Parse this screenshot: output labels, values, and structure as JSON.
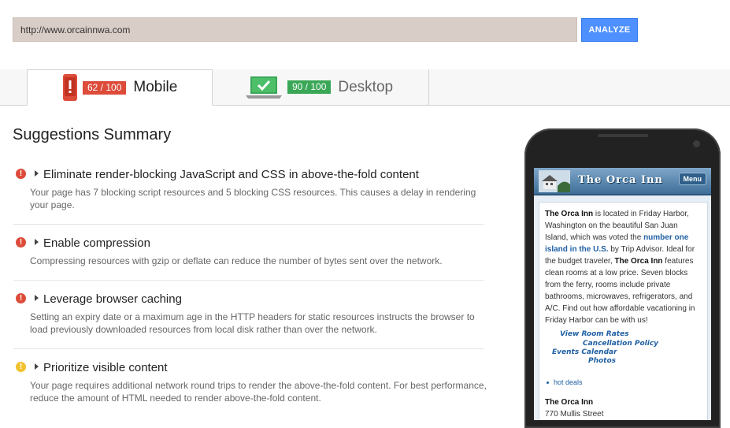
{
  "url_bar": {
    "value": "http://www.orcainnwa.com",
    "analyze_label": "ANALYZE"
  },
  "tabs": [
    {
      "label": "Mobile",
      "score": "62 / 100",
      "icon": "phone-warning-icon",
      "active": true
    },
    {
      "label": "Desktop",
      "score": "90 / 100",
      "icon": "laptop-check-icon",
      "active": false
    }
  ],
  "summary": {
    "title": "Suggestions Summary",
    "items": [
      {
        "severity": "red",
        "title": "Eliminate render-blocking JavaScript and CSS in above-the-fold content",
        "description": "Your page has 7 blocking script resources and 5 blocking CSS resources. This causes a delay in rendering your page."
      },
      {
        "severity": "red",
        "title": "Enable compression",
        "description": "Compressing resources with gzip or deflate can reduce the number of bytes sent over the network."
      },
      {
        "severity": "red",
        "title": "Leverage browser caching",
        "description": "Setting an expiry date or a maximum age in the HTTP headers for static resources instructs the browser to load previously downloaded resources from local disk rather than over the network."
      },
      {
        "severity": "yellow",
        "title": "Prioritize visible content",
        "description": "Your page requires additional network round trips to render the above-the-fold content. For best performance, reduce the amount of HTML needed to render above-the-fold content."
      }
    ]
  },
  "preview": {
    "site_title": "The Orca Inn",
    "menu_label": "Menu",
    "para_name": "The Orca Inn",
    "para_1": " is located in Friday Harbor, Washington on the beautiful San Juan Island, which was voted the ",
    "para_link": "number one island in the U.S.",
    "para_2": " by Trip Advisor. Ideal for the budget traveler, ",
    "para_name_2": "The Orca Inn",
    "para_3": " features clean rooms at a low price. Seven blocks from the ferry, rooms include private bathrooms, microwaves, refrigerators, and A/C. Find out how affordable vacationing in Friday Harbor can be with us!",
    "links": [
      "View Room Rates",
      "Cancellation Policy",
      "Events Calendar",
      "Photos"
    ],
    "bullet_link": "hot deals",
    "address_name": "The Orca Inn",
    "address_line": "770 Mullis Street"
  },
  "colors": {
    "accent_blue": "#4d90fe",
    "score_red": "#dd4b39",
    "score_green": "#3aa757",
    "warning_yellow": "#f2c12e"
  }
}
